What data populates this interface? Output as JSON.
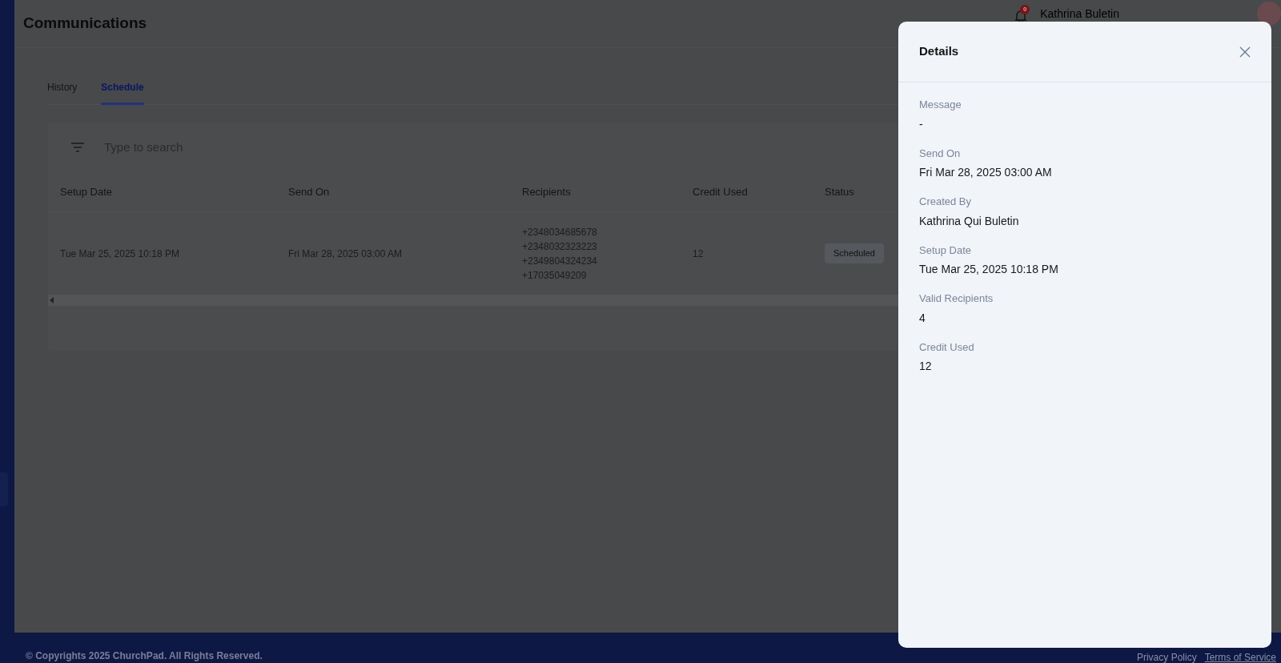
{
  "header": {
    "title": "Communications",
    "notifications": "0",
    "user_name": "Kathrina Buletin"
  },
  "tabs": [
    {
      "label": "History",
      "selected": false
    },
    {
      "label": "Schedule",
      "selected": true
    }
  ],
  "search": {
    "placeholder": "Type to search"
  },
  "table": {
    "columns": [
      "Setup Date",
      "Send On",
      "Recipients",
      "Credit Used",
      "Status"
    ],
    "rows": [
      {
        "setup_date": "Tue Mar 25, 2025 10:18 PM",
        "send_on": "Fri Mar 28, 2025 03:00 AM",
        "recipients": [
          "+2348034685678",
          "+2348032323223",
          "+2349804324234",
          "+17035049209"
        ],
        "credit_used": "12",
        "status": "Scheduled"
      }
    ]
  },
  "footer": {
    "copyright": "© Copyrights 2025 ChurchPad. All Rights Reserved.",
    "links": [
      "Privacy Policy",
      "Terms of Service"
    ]
  },
  "details": {
    "title": "Details",
    "fields": [
      {
        "label": "Message",
        "value": "-"
      },
      {
        "label": "Send On",
        "value": "Fri Mar 28, 2025 03:00 AM"
      },
      {
        "label": "Created By",
        "value": "Kathrina Qui Buletin"
      },
      {
        "label": "Setup Date",
        "value": "Tue Mar 25, 2025 10:18 PM"
      },
      {
        "label": "Valid Recipients",
        "value": "4"
      },
      {
        "label": "Credit Used",
        "value": "12"
      }
    ]
  }
}
